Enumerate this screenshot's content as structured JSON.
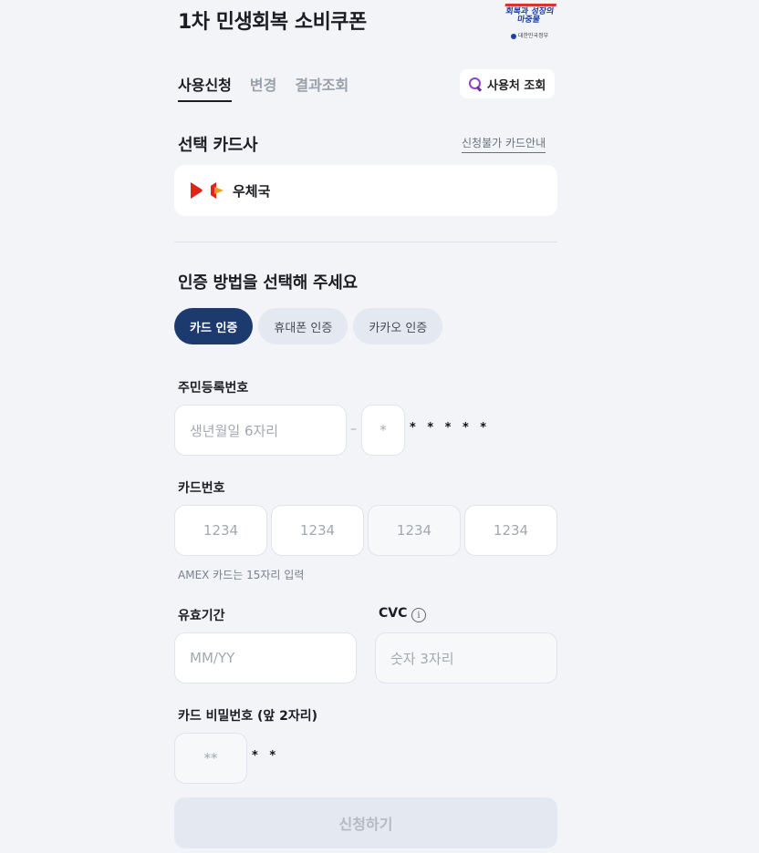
{
  "header": {
    "title": "1차 민생회복 소비쿠폰",
    "logo": {
      "slogan": "회복과 성장의 마중물",
      "govname": "대한민국정부"
    }
  },
  "tabs": [
    {
      "label": "사용신청",
      "active": true
    },
    {
      "label": "변경",
      "active": false
    },
    {
      "label": "결과조회",
      "active": false
    }
  ],
  "store_lookup": {
    "label": "사용처 조회",
    "icon": "magnifier-icon"
  },
  "card_section": {
    "title": "선택 카드사",
    "guide_link": "신청불가 카드안내",
    "selected_card": "우체국"
  },
  "auth_section": {
    "title": "인증 방법을 선택해 주세요",
    "methods": [
      {
        "label": "카드 인증",
        "active": true
      },
      {
        "label": "휴대폰 인증",
        "active": false
      },
      {
        "label": "카카오 인증",
        "active": false
      }
    ]
  },
  "resident_number": {
    "label": "주민등록번호",
    "birth_placeholder": "생년월일 6자리",
    "dash": "–",
    "gender_placeholder": "*",
    "masked_tail": "* * * * *"
  },
  "card_number": {
    "label": "카드번호",
    "placeholders": [
      "1234",
      "1234",
      "1234",
      "1234"
    ],
    "hint": "AMEX 카드는 15자리 입력"
  },
  "expiry": {
    "label": "유효기간",
    "placeholder": "MM/YY"
  },
  "cvc": {
    "label": "CVC",
    "placeholder": "숫자 3자리",
    "info_icon": "i"
  },
  "card_password": {
    "label": "카드 비밀번호 (앞 2자리)",
    "placeholder": "**",
    "masked_tail": "* *"
  },
  "submit": {
    "label": "신청하기",
    "enabled": false
  },
  "colors": {
    "primary": "#1d3a6e",
    "background": "#f2f4f8",
    "chip": "#e4e8f1"
  }
}
